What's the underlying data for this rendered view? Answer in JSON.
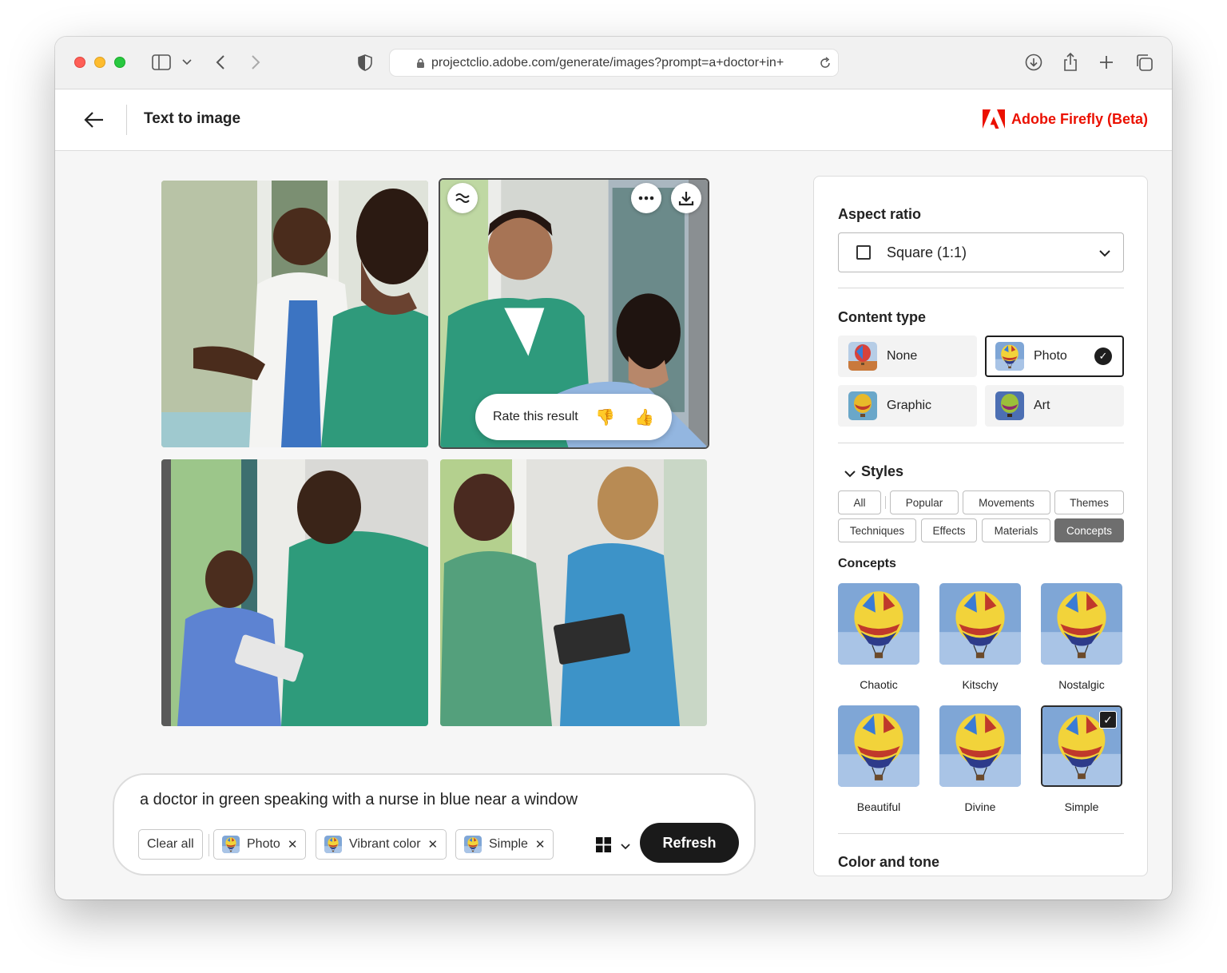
{
  "browser": {
    "url": "projectclio.adobe.com/generate/images?prompt=a+doctor+in+"
  },
  "header": {
    "title": "Text to image",
    "brand": "Adobe Firefly (Beta)",
    "brand_color": "#eb1000"
  },
  "gallery": {
    "rate_label": "Rate this result",
    "icons": [
      "variations-icon",
      "more-icon",
      "download-icon",
      "thumbs-down-icon",
      "thumbs-up-icon"
    ]
  },
  "prompt": {
    "text": "a doctor in green speaking with a nurse in blue near a window",
    "clear_label": "Clear all",
    "chips": [
      {
        "label": "Photo"
      },
      {
        "label": "Vibrant color"
      },
      {
        "label": "Simple"
      }
    ],
    "refresh_label": "Refresh"
  },
  "panel": {
    "aspect_title": "Aspect ratio",
    "aspect_value": "Square (1:1)",
    "content_title": "Content type",
    "content_types": [
      {
        "label": "None",
        "selected": false
      },
      {
        "label": "Photo",
        "selected": true
      },
      {
        "label": "Graphic",
        "selected": false
      },
      {
        "label": "Art",
        "selected": false
      }
    ],
    "styles_title": "Styles",
    "style_tabs": [
      "All",
      "Popular",
      "Movements",
      "Themes",
      "Techniques",
      "Effects",
      "Materials",
      "Concepts"
    ],
    "active_tab": "Concepts",
    "concepts_title": "Concepts",
    "concepts": [
      {
        "label": "Chaotic",
        "selected": false
      },
      {
        "label": "Kitschy",
        "selected": false
      },
      {
        "label": "Nostalgic",
        "selected": false
      },
      {
        "label": "Beautiful",
        "selected": false
      },
      {
        "label": "Divine",
        "selected": false
      },
      {
        "label": "Simple",
        "selected": true
      }
    ],
    "color_title": "Color and tone"
  }
}
